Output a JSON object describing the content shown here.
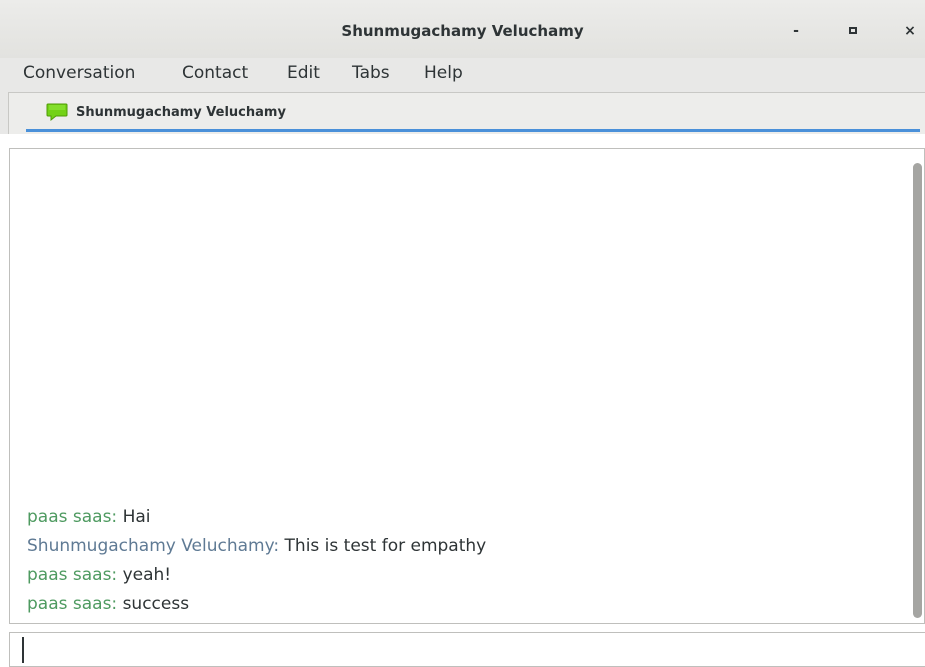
{
  "window": {
    "title": "Shunmugachamy Veluchamy",
    "minimize_label": "-",
    "close_label": "×"
  },
  "menubar": {
    "items": [
      {
        "label": "Conversation"
      },
      {
        "label": "Contact"
      },
      {
        "label": "Edit"
      },
      {
        "label": "Tabs"
      },
      {
        "label": "Help"
      }
    ]
  },
  "tabs": [
    {
      "label": "Shunmugachamy Veluchamy",
      "icon": "chat-bubble-icon"
    }
  ],
  "messages": [
    {
      "sender": "paas saas:",
      "text": " Hai",
      "self": true
    },
    {
      "sender": "Shunmugachamy Veluchamy:",
      "text": " This is test for empathy",
      "self": false
    },
    {
      "sender": "paas saas:",
      "text": " yeah!",
      "self": true
    },
    {
      "sender": "paas saas:",
      "text": " success",
      "self": true
    }
  ],
  "input": {
    "value": "",
    "placeholder": ""
  },
  "colors": {
    "self_nick": "#4e9a60",
    "other_nick": "#5f7a94",
    "accent": "#4a90d9",
    "chat_icon": "#73d216"
  }
}
